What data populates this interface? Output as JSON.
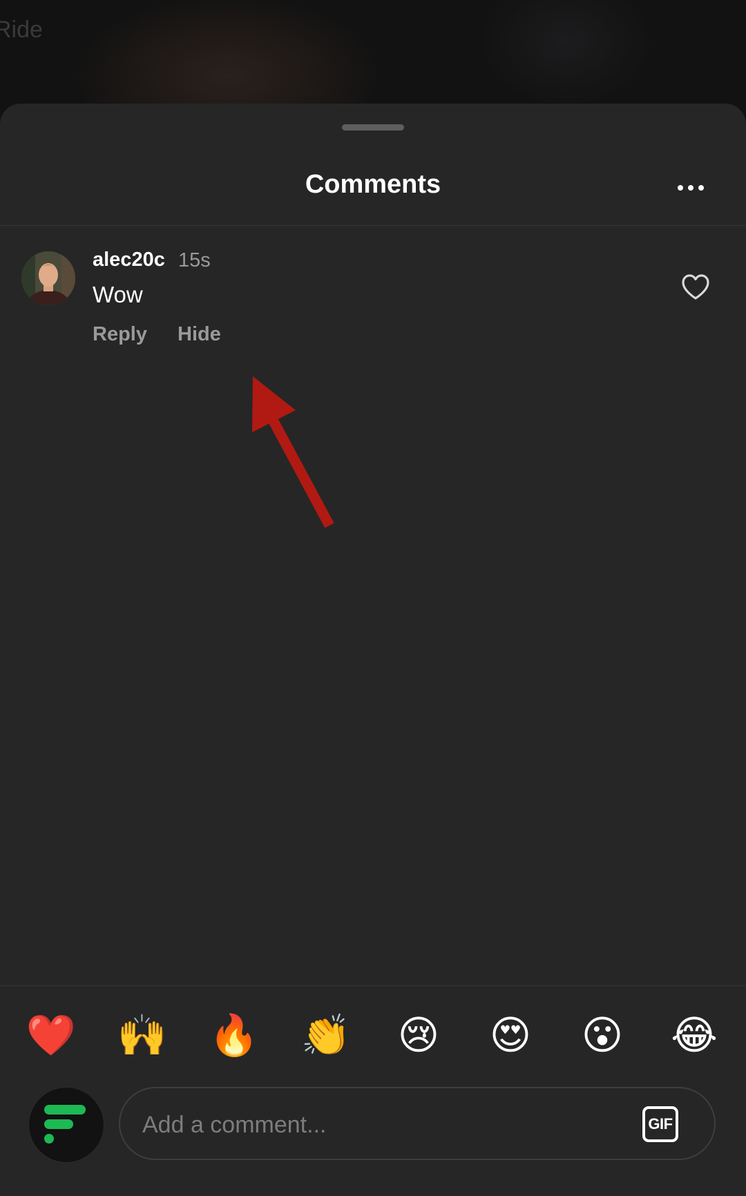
{
  "background": {
    "partial_text": "Ride"
  },
  "header": {
    "title": "Comments",
    "more_icon": "more-horizontal-icon"
  },
  "comments": [
    {
      "username": "alec20c",
      "time": "15s",
      "text": "Wow",
      "reply_label": "Reply",
      "hide_label": "Hide",
      "like_icon": "heart-outline-icon"
    }
  ],
  "reactions": [
    "❤️",
    "🙌",
    "🔥",
    "👏",
    "😢",
    "😍",
    "😮",
    "😂"
  ],
  "composer": {
    "placeholder": "Add a comment...",
    "gif_label": "GIF"
  },
  "colors": {
    "sheet": "#262626",
    "muted_text": "#9a9a9a",
    "annotation_arrow": "#b01a12",
    "brand_green": "#1db954"
  }
}
